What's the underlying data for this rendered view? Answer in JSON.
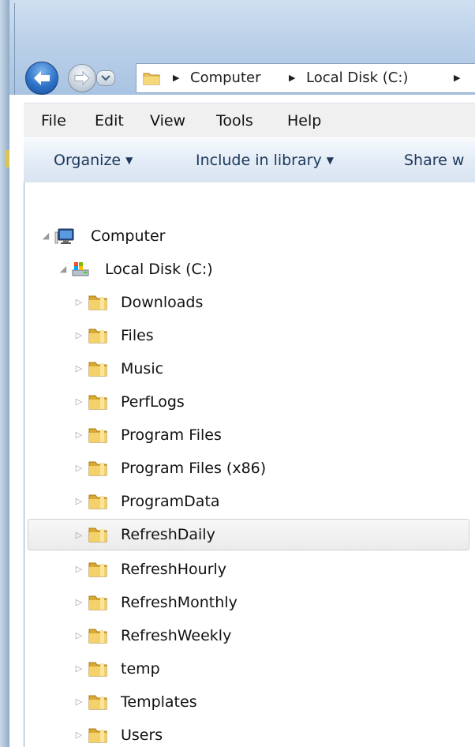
{
  "nav": {
    "breadcrumb": [
      "Computer",
      "Local Disk (C:)"
    ]
  },
  "menu": {
    "items": [
      "File",
      "Edit",
      "View",
      "Tools",
      "Help"
    ]
  },
  "toolbar": {
    "organize": "Organize",
    "include_in_library": "Include in library",
    "share_with": "Share w"
  },
  "tree": {
    "computer": "Computer",
    "local_disk": "Local Disk (C:)",
    "folders": [
      "Downloads",
      "Files",
      "Music",
      "PerfLogs",
      "Program Files",
      "Program Files (x86)",
      "ProgramData",
      "RefreshDaily",
      "RefreshHourly",
      "RefreshMonthly",
      "RefreshWeekly",
      "temp",
      "Templates",
      "Users"
    ],
    "selected_folder": "RefreshDaily"
  },
  "icons": {
    "back": "back-arrow-icon",
    "forward": "forward-arrow-icon",
    "folder": "folder-icon",
    "computer": "computer-icon",
    "drive": "drive-icon"
  },
  "colors": {
    "toolbar_text": "#1e395b",
    "back_button": "#2d72c7",
    "folder": "#e8c15a"
  }
}
